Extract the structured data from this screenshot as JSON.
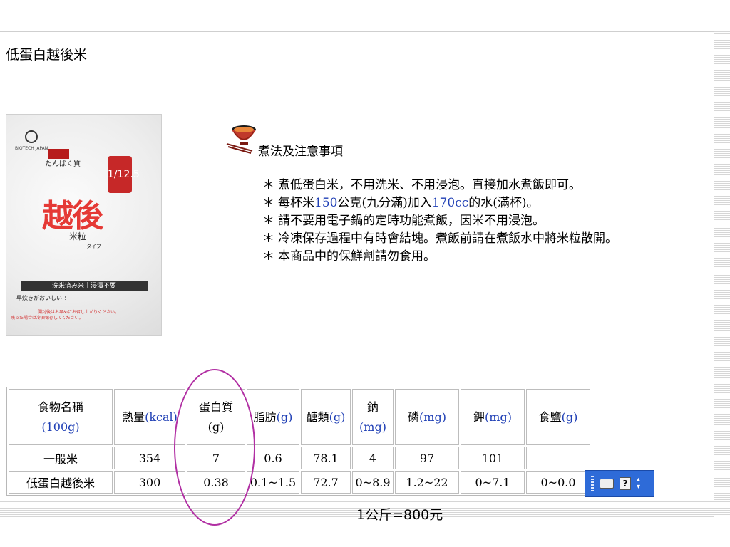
{
  "slide": {
    "title": "低蛋白越後米",
    "heading": "煮法及注意事項",
    "notes": [
      {
        "star": "＊",
        "segments": [
          "煮低蛋白米，不用洗米、不用浸泡。直接加水煮飯即可。"
        ]
      },
      {
        "star": "＊",
        "segments": [
          "每杯米",
          "150",
          "公克(九分滿)加入",
          "170cc",
          "的水(滿杯)。"
        ]
      },
      {
        "star": "＊",
        "segments": [
          "請不要用電子鍋的定時功能煮飯，因米不用浸泡。"
        ]
      },
      {
        "star": "＊",
        "segments": [
          "冷凍保存過程中有時會結塊。煮飯前請在煮飯水中將米粒散開。"
        ]
      },
      {
        "star": "＊",
        "segments": [
          "本商品中的保鮮劑請勿食用。"
        ]
      }
    ],
    "price_line": "1公斤=800元"
  },
  "product_package": {
    "brand": "BIOTECH JAPAN",
    "protein_label": "たんぱく質",
    "ratio": "1/12.5",
    "big_name": "越後",
    "grain_label": "米粒",
    "type_label": "タイプ",
    "bar_text": "洗米済み米｜浸漬不要",
    "tagline": "早炊きがおいしい!!",
    "note1": "開封後はお早めにお召し上がりください。",
    "note2": "残った場合は冷凍保存してください。"
  },
  "table": {
    "header": [
      {
        "text": "食物名稱",
        "unit": "(100g)"
      },
      {
        "text": "熱量",
        "unit": "(kcal)"
      },
      {
        "text": "蛋白質",
        "unit": "(g)"
      },
      {
        "text": "脂肪",
        "unit": "(g)"
      },
      {
        "text": "醣類",
        "unit": "(g)"
      },
      {
        "text": "鈉",
        "unit": "(mg)"
      },
      {
        "text": "磷",
        "unit": "(mg)"
      },
      {
        "text": "鉀",
        "unit": "(mg)"
      },
      {
        "text": "食鹽",
        "unit": "(g)"
      }
    ],
    "rows": [
      [
        "一般米",
        "354",
        "7",
        "0.6",
        "78.1",
        "4",
        "97",
        "101",
        ""
      ],
      [
        "低蛋白越後米",
        "300",
        "0.38",
        "0.1~1.5",
        "72.7",
        "0~8.9",
        "1.2~22",
        "0~7.1",
        "0~0.0"
      ]
    ]
  },
  "colors": {
    "highlight_circle": "#b12fa3",
    "number_blue": "#1f3fb5",
    "toolbar_blue": "#2e6bd8",
    "package_red": "#e53935"
  },
  "icons": [
    "rice-bowl-icon",
    "keyboard-icon",
    "help-icon",
    "toolbar-options-icon"
  ]
}
